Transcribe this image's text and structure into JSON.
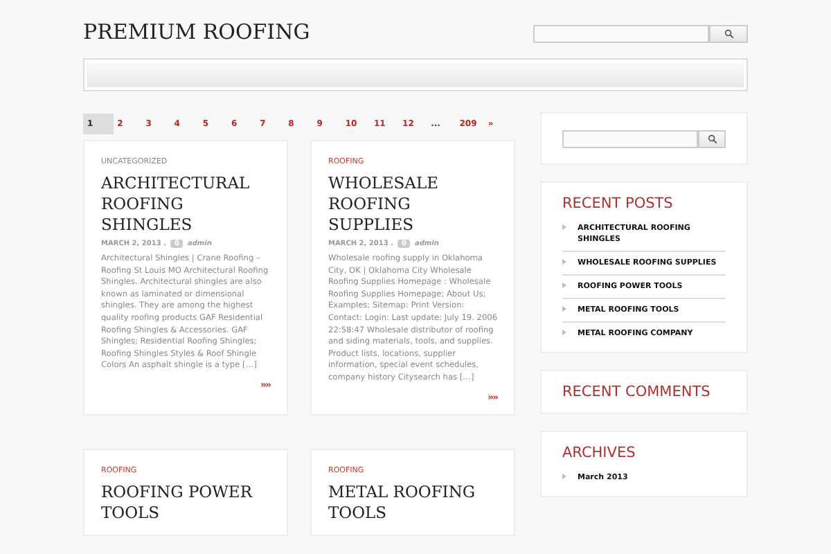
{
  "header": {
    "site_title": "PREMIUM ROOFING"
  },
  "pagination": [
    {
      "label": "1",
      "selected": true
    },
    {
      "label": "2",
      "selected": false
    },
    {
      "label": "3",
      "selected": false
    },
    {
      "label": "4",
      "selected": false
    },
    {
      "label": "5",
      "selected": false
    },
    {
      "label": "6",
      "selected": false
    },
    {
      "label": "7",
      "selected": false
    },
    {
      "label": "8",
      "selected": false
    },
    {
      "label": "9",
      "selected": false
    },
    {
      "label": "10",
      "selected": false
    },
    {
      "label": "11",
      "selected": false
    },
    {
      "label": "12",
      "selected": false
    },
    {
      "label": "...",
      "selected": false,
      "kind": "gap"
    },
    {
      "label": "209",
      "selected": false
    },
    {
      "label": "»",
      "selected": false
    }
  ],
  "posts": [
    {
      "category": "UNCATEGORIZED",
      "color": "#888888",
      "title": "ARCHITECTURAL ROOFING SHINGLES",
      "date": "MARCH 2, 2013 .",
      "comments": "0",
      "author": "admin",
      "excerpt": "Architectural Shingles | Crane Roofing – Roofing St Louis MO Architectural Roofing Shingles. Architectural shingles are also known as laminated or dimensional shingles. They are among the highest quality roofing products GAF Residential Roofing Shingles & Accessories. GAF Shingles; Residential Roofing Shingles; Roofing Shingles Styles & Roof Shingle Colors An asphalt shingle is a type […]",
      "more": "»»"
    },
    {
      "category": "ROOFING",
      "color": "#c0392b",
      "title": "WHOLESALE ROOFING SUPPLIES",
      "date": "MARCH 2, 2013 .",
      "comments": "0",
      "author": "admin",
      "excerpt": "Wholesale roofing supply in Oklahoma City, OK | Oklahoma City Wholesale Roofing Supplies Homepage : Wholesale Roofing Supplies Homepage; About Us; Examples; Sitemap: Print Version: Contact: Login: Last update: July 19. 2006 22:58:47 Wholesale distributor of roofing and siding materials, tools, and supplies. Product lists, locations, supplier information, special event schedules, company history Citysearch has […]",
      "more": "»»"
    },
    {
      "category": "ROOFING",
      "color": "#c0392b",
      "title": "ROOFING POWER TOOLS"
    },
    {
      "category": "ROOFING",
      "color": "#c0392b",
      "title": "METAL ROOFING TOOLS"
    }
  ],
  "sidebar": {
    "recent_posts": {
      "title": "RECENT POSTS",
      "items": [
        "ARCHITECTURAL ROOFING SHINGLES",
        "WHOLESALE ROOFING SUPPLIES",
        "ROOFING POWER TOOLS",
        "METAL ROOFING TOOLS",
        "METAL ROOFING COMPANY"
      ]
    },
    "recent_comments": {
      "title": "RECENT COMMENTS"
    },
    "archives": {
      "title": "ARCHIVES",
      "items": [
        "March 2013"
      ]
    }
  }
}
